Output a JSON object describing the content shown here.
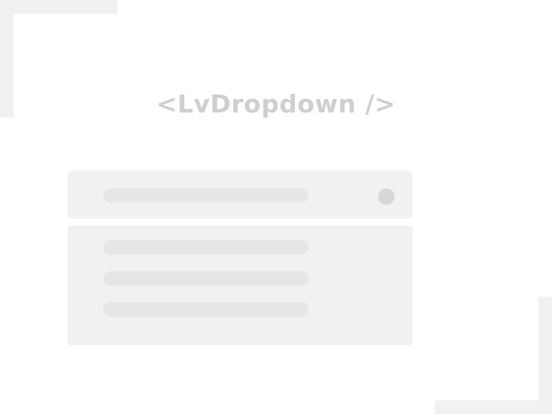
{
  "title": "<LvDropdown />",
  "colors": {
    "background": "#ffffff",
    "corner_decoration": "#f1f1f1",
    "title_text": "#cfcfcf",
    "surface": "#f1f1f1",
    "skeleton_bar": "#e6e6e6",
    "indicator": "#d7d7d7"
  },
  "dropdown": {
    "selected_value": "",
    "indicator_icon": "dropdown-indicator-icon",
    "options": [
      "",
      "",
      ""
    ]
  }
}
